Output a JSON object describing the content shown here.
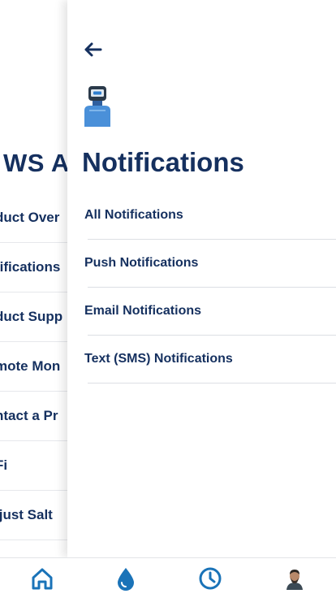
{
  "background_screen": {
    "title": "WS A",
    "items": [
      {
        "label": "duct Over"
      },
      {
        "label": "tifications"
      },
      {
        "label": "duct Supp"
      },
      {
        "label": "mote Mon"
      },
      {
        "label": "ntact a Pr"
      },
      {
        "label": "Fi"
      },
      {
        "label": "ljust Salt"
      }
    ]
  },
  "panel": {
    "back_icon": "arrow-left-icon",
    "device_icon": "water-softener-device-icon",
    "title": "Notifications",
    "items": [
      {
        "label": "All Notifications"
      },
      {
        "label": "Push Notifications"
      },
      {
        "label": "Email Notifications"
      },
      {
        "label": "Text (SMS) Notifications"
      }
    ]
  },
  "tabbar": {
    "tabs": [
      {
        "icon": "home-icon"
      },
      {
        "icon": "water-drop-icon"
      },
      {
        "icon": "clock-icon"
      },
      {
        "icon": "profile-avatar-icon"
      }
    ],
    "accent_color": "#1a73b8"
  },
  "colors": {
    "primary_text": "#15305f",
    "accent": "#1a73b8"
  }
}
